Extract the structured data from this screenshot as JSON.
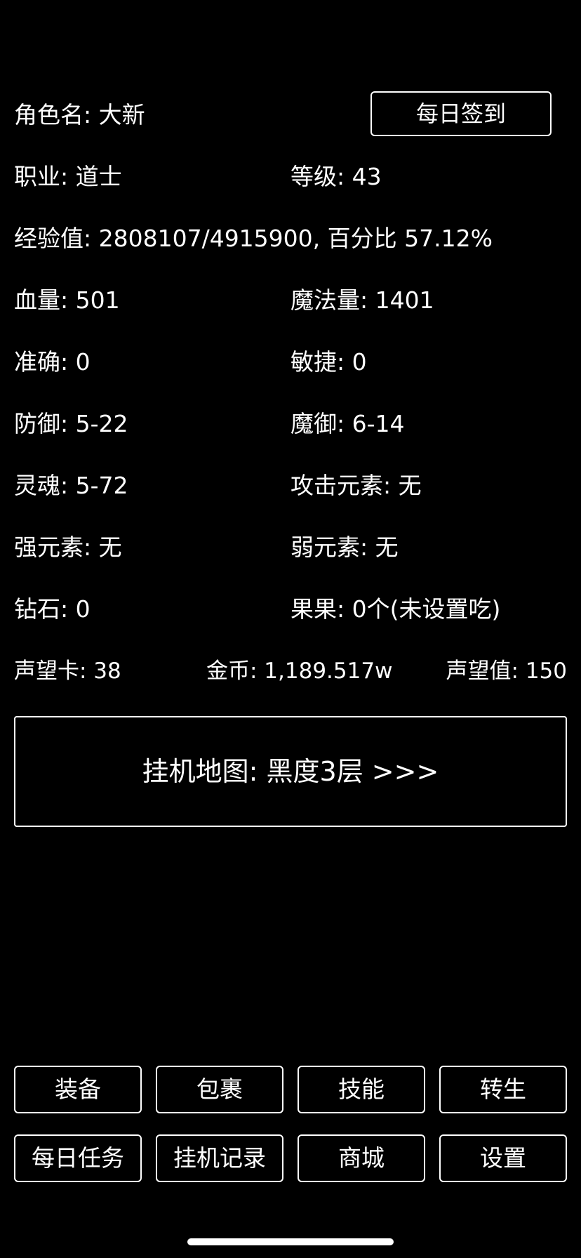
{
  "header": {
    "name_label": "角色名: 大新",
    "sign_in_button": "每日签到"
  },
  "stats": {
    "job": "职业: 道士",
    "level": "等级: 43",
    "exp": "经验值: 2808107/4915900, 百分比 57.12%",
    "hp": "血量: 501",
    "mp": "魔法量: 1401",
    "accuracy": "准确: 0",
    "agility": "敏捷: 0",
    "defense": "防御: 5-22",
    "magic_defense": "魔御: 6-14",
    "soul": "灵魂: 5-72",
    "attack_element": "攻击元素: 无",
    "strong_element": "强元素: 无",
    "weak_element": "弱元素: 无",
    "diamond": "钻石: 0",
    "fruit": "果果: 0个(未设置吃)",
    "reputation_card": "声望卡: 38",
    "gold": "金币: 1,189.517w",
    "reputation_value": "声望值: 150"
  },
  "map": {
    "label": "挂机地图: 黑度3层 >>>"
  },
  "menu": {
    "row1": [
      "装备",
      "包裹",
      "技能",
      "转生"
    ],
    "row2": [
      "每日任务",
      "挂机记录",
      "商城",
      "设置"
    ]
  }
}
